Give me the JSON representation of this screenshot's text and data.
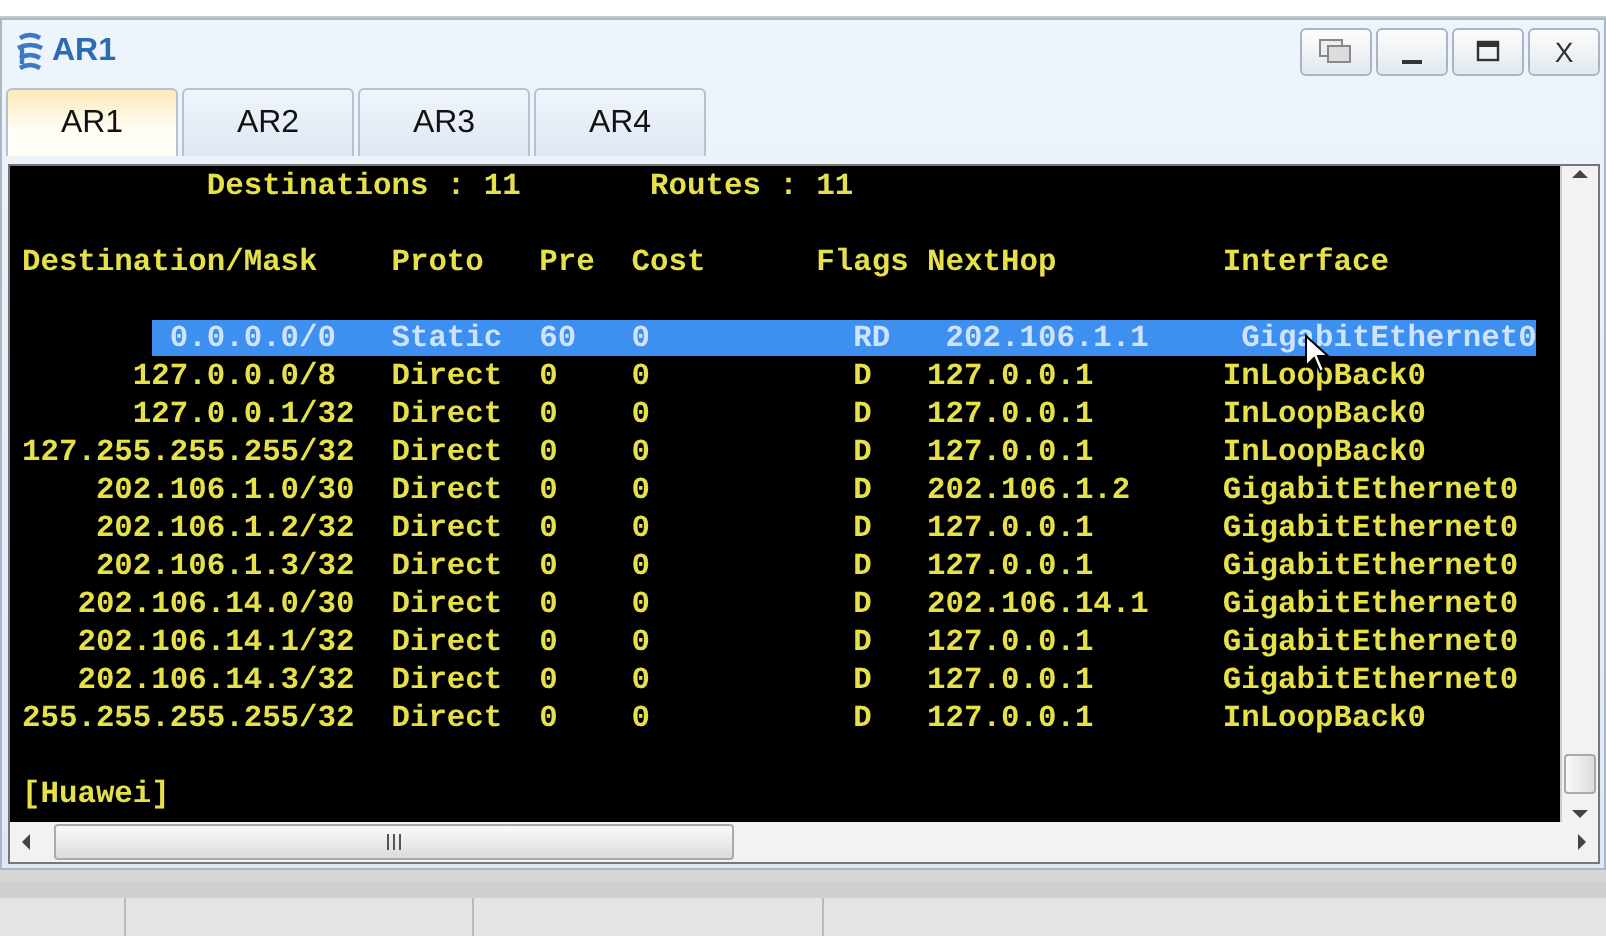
{
  "window": {
    "title": "AR1",
    "close_label": "X"
  },
  "tabs": [
    {
      "label": "AR1",
      "selected": true
    },
    {
      "label": "AR2",
      "selected": false
    },
    {
      "label": "AR3",
      "selected": false
    },
    {
      "label": "AR4",
      "selected": false
    }
  ],
  "terminal": {
    "lines": [
      {
        "kind": "summary",
        "text": "          Destinations : 11       Routes : 11"
      },
      {
        "kind": "header",
        "text": "Destination/Mask    Proto   Pre  Cost      Flags NextHop         Interface"
      },
      {
        "kind": "route",
        "text": "        0.0.0.0/0   Static  60   0           RD   202.106.1.1     GigabitEthernet0",
        "selected": true
      },
      {
        "kind": "route",
        "text": "      127.0.0.0/8   Direct  0    0           D   127.0.0.1       InLoopBack0",
        "selected": false
      },
      {
        "kind": "route",
        "text": "      127.0.0.1/32  Direct  0    0           D   127.0.0.1       InLoopBack0",
        "selected": false
      },
      {
        "kind": "route",
        "text": "127.255.255.255/32  Direct  0    0           D   127.0.0.1       InLoopBack0",
        "selected": false
      },
      {
        "kind": "route",
        "text": "    202.106.1.0/30  Direct  0    0           D   202.106.1.2     GigabitEthernet0",
        "selected": false
      },
      {
        "kind": "route",
        "text": "    202.106.1.2/32  Direct  0    0           D   127.0.0.1       GigabitEthernet0",
        "selected": false
      },
      {
        "kind": "route",
        "text": "    202.106.1.3/32  Direct  0    0           D   127.0.0.1       GigabitEthernet0",
        "selected": false
      },
      {
        "kind": "route",
        "text": "   202.106.14.0/30  Direct  0    0           D   202.106.14.1    GigabitEthernet0",
        "selected": false
      },
      {
        "kind": "route",
        "text": "   202.106.14.1/32  Direct  0    0           D   127.0.0.1       GigabitEthernet0",
        "selected": false
      },
      {
        "kind": "route",
        "text": "   202.106.14.3/32  Direct  0    0           D   127.0.0.1       GigabitEthernet0",
        "selected": false
      },
      {
        "kind": "route",
        "text": "255.255.255.255/32  Direct  0    0           D   127.0.0.1       InLoopBack0",
        "selected": false
      },
      {
        "kind": "prompt",
        "text": "[Huawei]"
      }
    ]
  }
}
